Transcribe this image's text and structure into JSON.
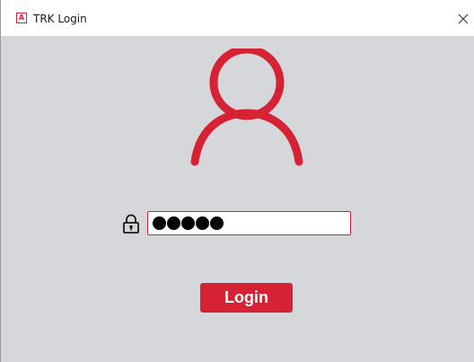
{
  "window": {
    "title": "TRK Login",
    "app_icon_letter": "A",
    "close_icon": "close-icon"
  },
  "main": {
    "avatar_icon": "user-avatar-icon",
    "lock_icon": "lock-icon",
    "password_dot_count": 5,
    "login_label": "Login"
  },
  "colors": {
    "accent": "#d62235",
    "background": "#d6d7db",
    "titlebar": "#ffffff"
  }
}
